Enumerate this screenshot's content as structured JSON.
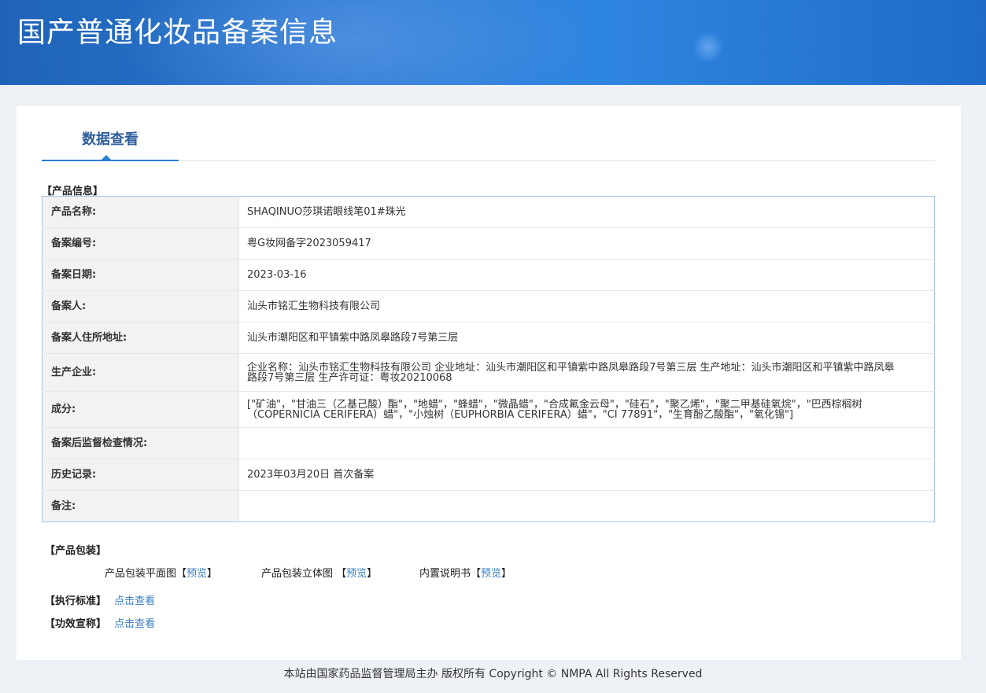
{
  "banner": {
    "title": "国产普通化妆品备案信息"
  },
  "tab": {
    "label": "数据查看"
  },
  "product_info": {
    "section_title": "【产品信息】",
    "rows": [
      {
        "label": "产品名称:",
        "value": "SHAQINUO莎琪诺眼线笔01#珠光"
      },
      {
        "label": "备案编号:",
        "value": "粤G妆网备字2023059417"
      },
      {
        "label": "备案日期:",
        "value": "2023-03-16"
      },
      {
        "label": "备案人:",
        "value": "汕头市铭汇生物科技有限公司"
      },
      {
        "label": "备案人住所地址:",
        "value": "汕头市潮阳区和平镇紫中路凤皋路段7号第三层"
      },
      {
        "label": "生产企业:",
        "value": "企业名称：汕头市铭汇生物科技有限公司 企业地址：汕头市潮阳区和平镇紫中路凤皋路段7号第三层 生产地址：汕头市潮阳区和平镇紫中路凤皋路段7号第三层 生产许可证：粤妆20210068"
      },
      {
        "label": "成分:",
        "value": "[\"矿油\"，\"甘油三（乙基己酸）酯\"，\"地蜡\"，\"蜂蜡\"，\"微晶蜡\"，\"合成氟金云母\"，\"硅石\"，\"聚乙烯\"，\"聚二甲基硅氧烷\"，\"巴西棕榈树（COPERNICIA CERIFERA）蜡\"，\"小烛树（EUPHORBIA CERIFERA）蜡\"，\"CI 77891\"，\"生育酚乙酸酯\"，\"氧化锡\"]"
      },
      {
        "label": "备案后监督检查情况:",
        "value": ""
      },
      {
        "label": "历史记录:",
        "value": "2023年03月20日 首次备案"
      },
      {
        "label": "备注:",
        "value": ""
      }
    ]
  },
  "packaging": {
    "section_title": "【产品包装】",
    "items": [
      {
        "label": "产品包装平面图",
        "link_open": "【",
        "link": "预览",
        "link_close": "】"
      },
      {
        "label": "产品包装立体图 ",
        "link_open": "【",
        "link": "预览",
        "link_close": "】"
      },
      {
        "label": "内置说明书",
        "link_open": "【",
        "link": "预览",
        "link_close": "】"
      }
    ]
  },
  "standard": {
    "section_title": "【执行标准】",
    "link": "点击查看"
  },
  "efficacy": {
    "section_title": "【功效宣称】",
    "link": "点击查看"
  },
  "footer": {
    "text": "本站由国家药品监督管理局主办 版权所有 Copyright © NMPA All Rights Reserved"
  }
}
